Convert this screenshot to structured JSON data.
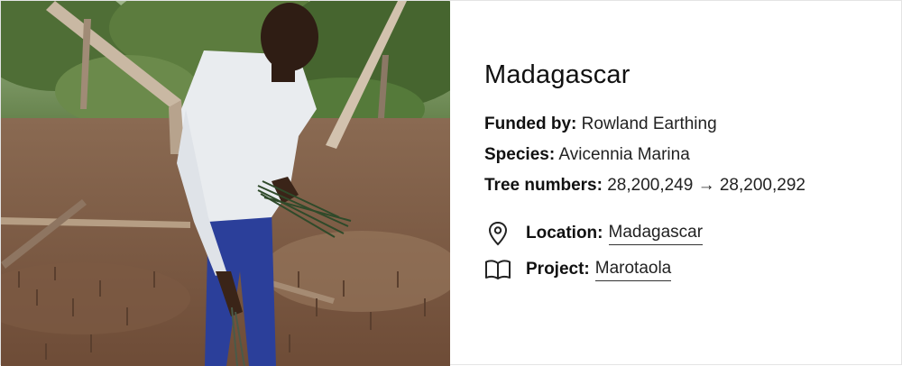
{
  "card": {
    "title": "Madagascar",
    "funded_by_label": "Funded by:",
    "funded_by_value": "Rowland Earthing",
    "species_label": "Species:",
    "species_value": "Avicennia Marina",
    "tree_numbers_label": "Tree numbers:",
    "tree_numbers_value": "28,200,249 → 28,200,292",
    "location_label": "Location:",
    "location_value": "Madagascar",
    "project_label": "Project:",
    "project_value": "Marotaola",
    "icons": {
      "location": "map-pin-icon",
      "project": "open-book-icon"
    }
  }
}
